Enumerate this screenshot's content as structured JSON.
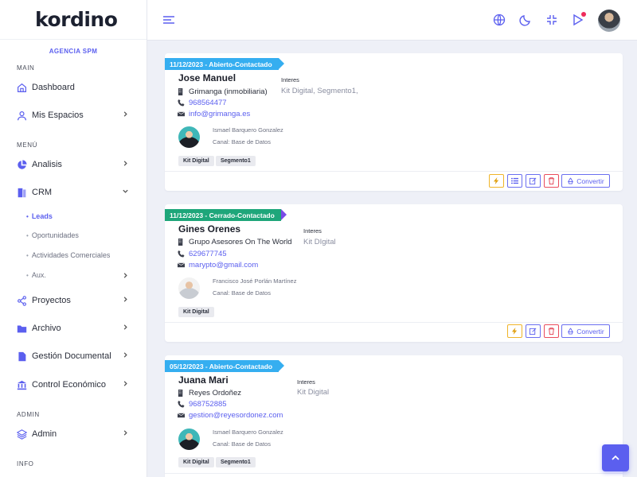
{
  "app": {
    "logo_text": "kordino",
    "org_name": "AGENCIA SPM"
  },
  "sidebar": {
    "sections": {
      "main": "MAIN",
      "menu": "MENÚ",
      "admin": "ADMIN",
      "info": "INFO"
    },
    "items": {
      "dashboard": "Dashboard",
      "mis_espacios": "Mis Espacios",
      "analisis": "Analisis",
      "crm": "CRM",
      "proyectos": "Proyectos",
      "archivo": "Archivo",
      "gestion_documental": "Gestión Documental",
      "control_economico": "Control Económico",
      "admin": "Admin"
    },
    "crm_sub": {
      "leads": "Leads",
      "oportunidades": "Oportunidades",
      "actividades": "Actividades Comerciales",
      "aux": "Aux."
    }
  },
  "interest_label": "Interes",
  "convert_label": "Convertir",
  "leads": [
    {
      "status": "11/12/2023 - Abierto-Contactado",
      "name": "Jose Manuel",
      "company": "Grimanga (inmobiliaria)",
      "phone": "968564477",
      "email": "info@grimanga.es",
      "interest": "Kit Digital, Segmento1,",
      "agent": "Ismael Barquero Gonzalez",
      "channel": "Canal: Base de Datos",
      "tags": [
        "Kit Digital",
        "Segmento1"
      ]
    },
    {
      "status": "11/12/2023 - Cerrado-Contactado",
      "name": "Gines Orenes",
      "company": "Grupo Asesores On The World",
      "phone": "629677745",
      "email": "marypto@gmail.com",
      "interest": "Kit DIgital",
      "agent": "Francisco José Porlán Martínez",
      "channel": "Canal: Base de Datos",
      "tags": [
        "Kit Digital"
      ]
    },
    {
      "status": "05/12/2023 - Abierto-Contactado",
      "name": "Juana Mari",
      "company": "Reyes Ordoñez",
      "phone": "968752885",
      "email": "gestion@reyesordonez.com",
      "interest": "Kit Digital",
      "agent": "Ismael Barquero Gonzalez",
      "channel": "Canal: Base de Datos",
      "tags": [
        "Kit Digital",
        "Segmento1"
      ]
    }
  ],
  "colors": {
    "accent": "#5b5fef",
    "status_open": "#35aef0",
    "status_closed": "#1ea67a"
  }
}
